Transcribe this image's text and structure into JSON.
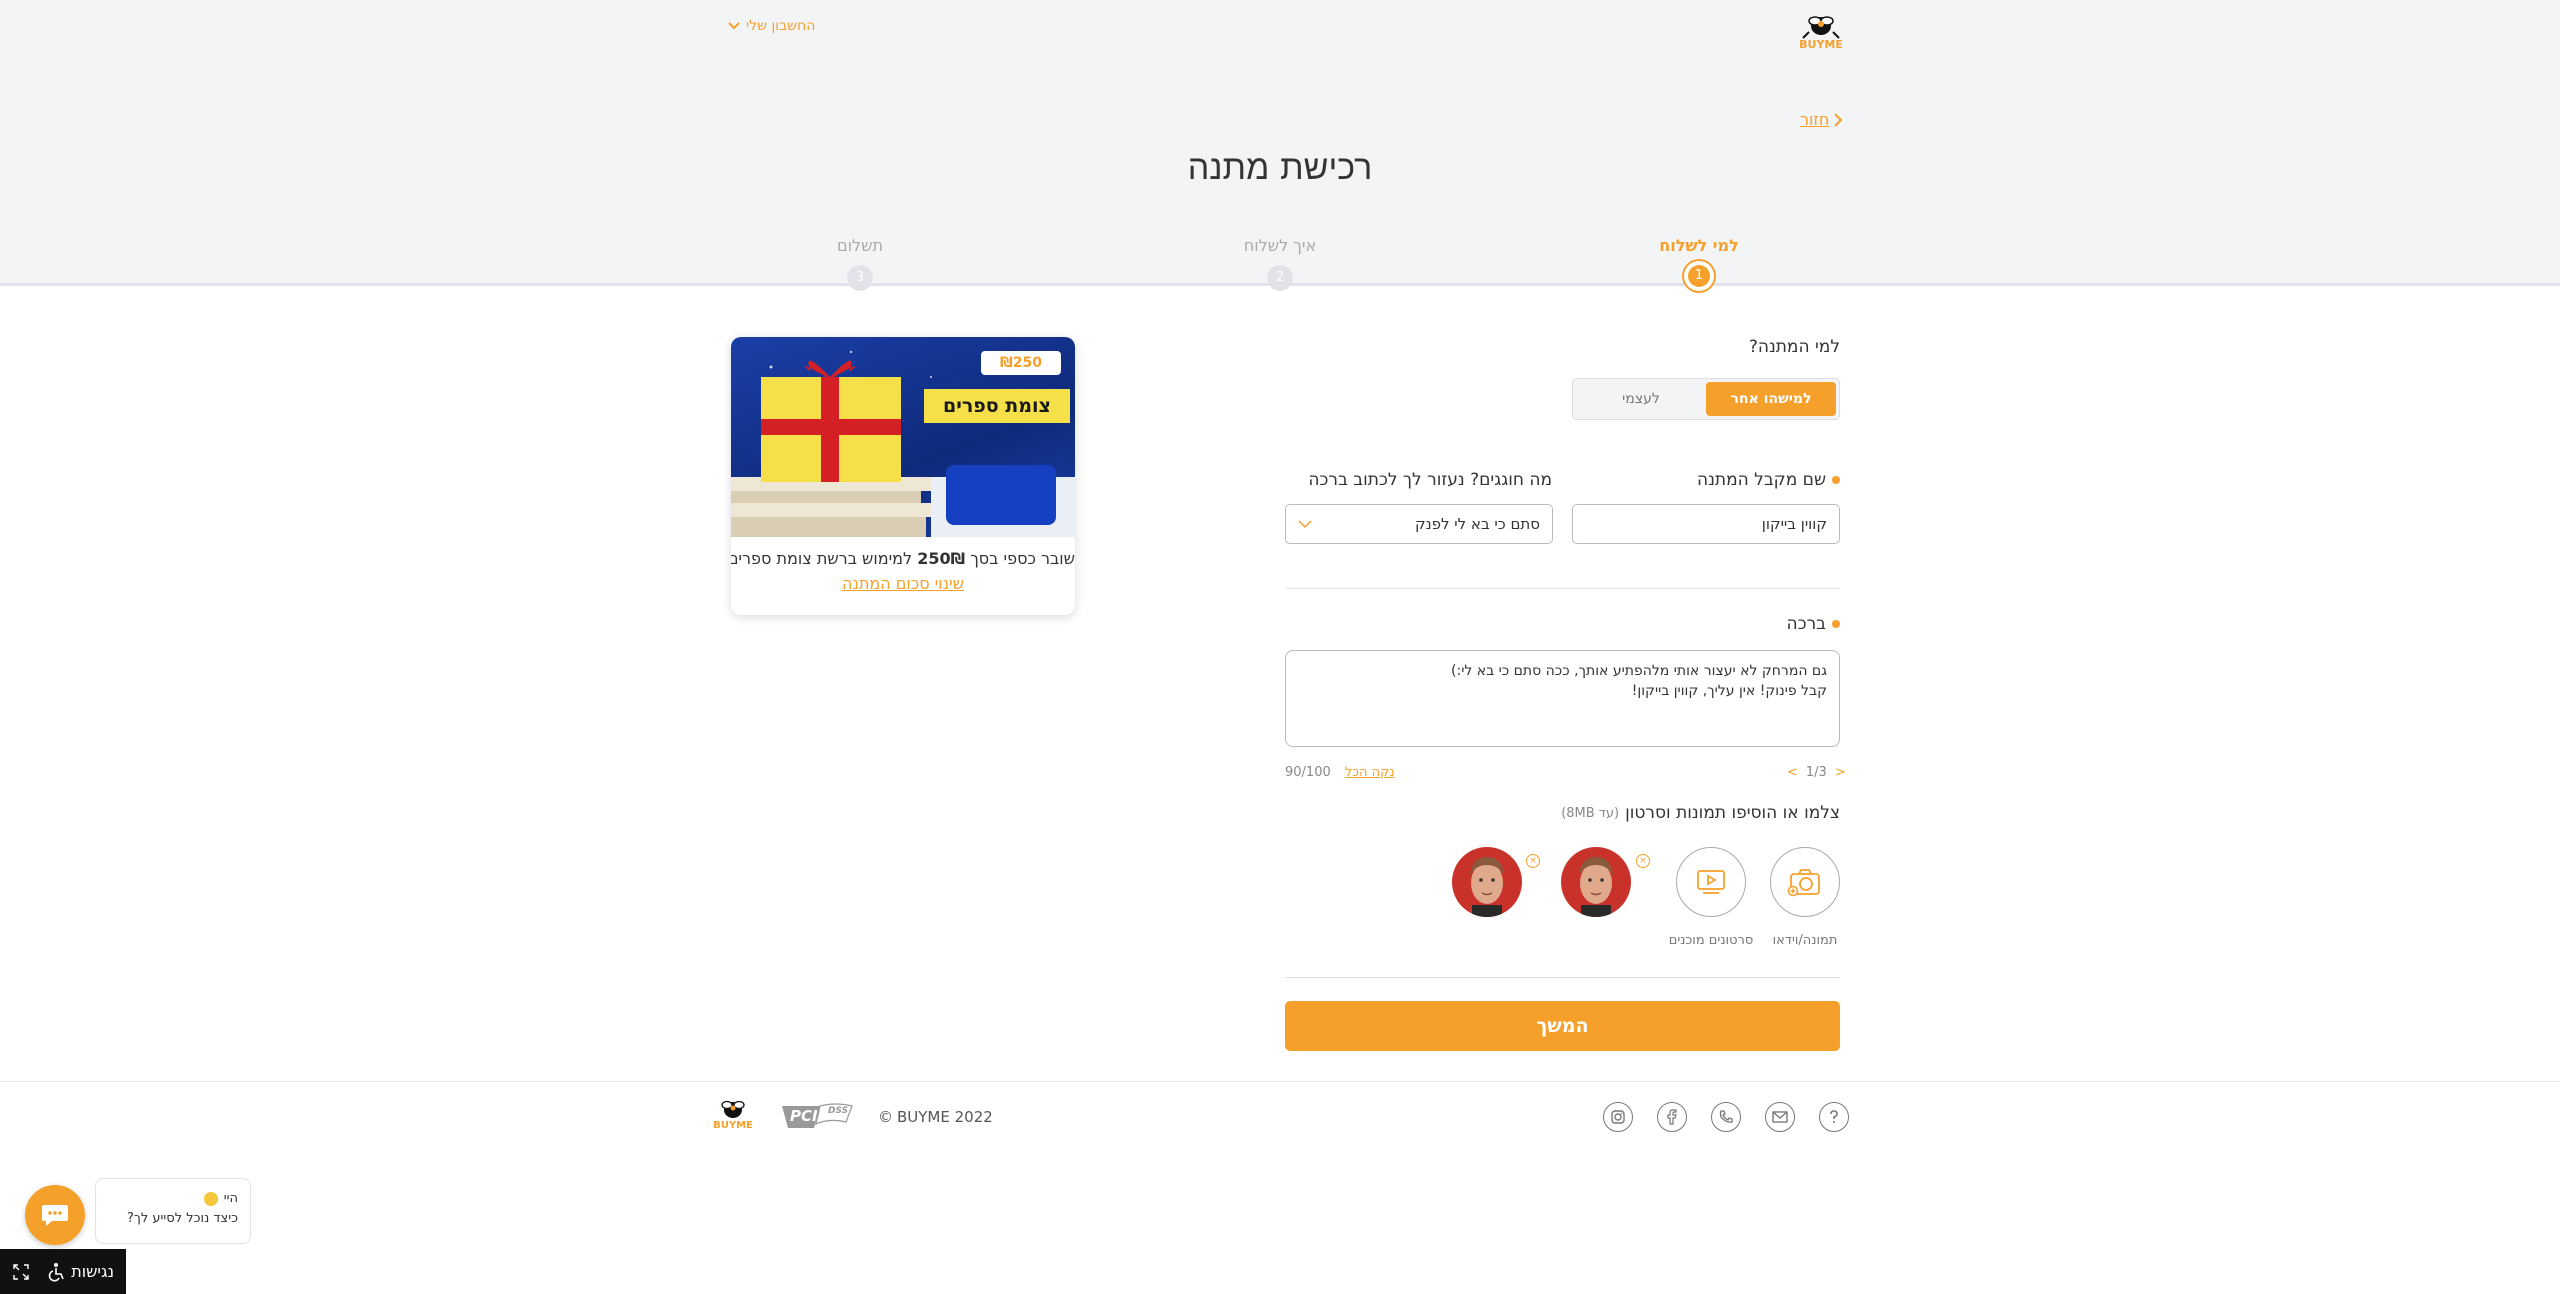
{
  "header": {
    "account_label": "החשבון שלי",
    "logo_text": "BUYME",
    "back_label": "חזור",
    "page_title": "רכישת מתנה"
  },
  "steps": [
    {
      "number": "1",
      "label": "למי לשלוח",
      "active": true
    },
    {
      "number": "2",
      "label": "איך לשלוח",
      "active": false
    },
    {
      "number": "3",
      "label": "תשלום",
      "active": false
    }
  ],
  "form": {
    "who_question": "למי המתנה?",
    "toggle_someone": "למישהו אחר",
    "toggle_self": "לעצמי",
    "recipient_label": "שם מקבל המתנה",
    "recipient_value": "קווין בייקון",
    "occasion_label": "מה חוגגים? נעזור לך לכתוב ברכה",
    "occasion_value": "סתם כי בא לי לפנק",
    "greeting_label": "ברכה",
    "greeting_value": "גם המרחק לא יעצור אותי מלהפתיע אותך, ככה סתם כי בא לי:)\nקבל פינוק! אין עליך, קווין בייקון!",
    "pager_prev": "<",
    "pager_text": "1/3",
    "pager_next": ">",
    "clear_all": "נקה הכל",
    "char_count": "90/100",
    "media_title": "צלמו או הוסיפו תמונות וסרטון",
    "media_limit": "(עד 8MB)",
    "media_photo_caption": "תמונה/וידאו",
    "media_video_caption": "סרטונים מוכנים",
    "continue_label": "המשך"
  },
  "gift_card": {
    "price_badge": "₪250",
    "brand_text": "צומת ספרים",
    "desc_prefix": "שובר כספי בסך",
    "desc_amount": "250₪",
    "desc_suffix": "למימוש ברשת צומת ספרים",
    "change_amount": "שינוי סכום המתנה"
  },
  "footer": {
    "copyright": "BUYME 2022",
    "copyright_symbol": "©",
    "pci_text": "PCI",
    "dss_text": "DSS"
  },
  "chat": {
    "greeting": "היי",
    "question": "כיצד נוכל לסייע לך?"
  },
  "accessibility": {
    "label": "נגישות"
  },
  "colors": {
    "accent": "#f5a02b",
    "header_bg": "#f3f4f6"
  }
}
